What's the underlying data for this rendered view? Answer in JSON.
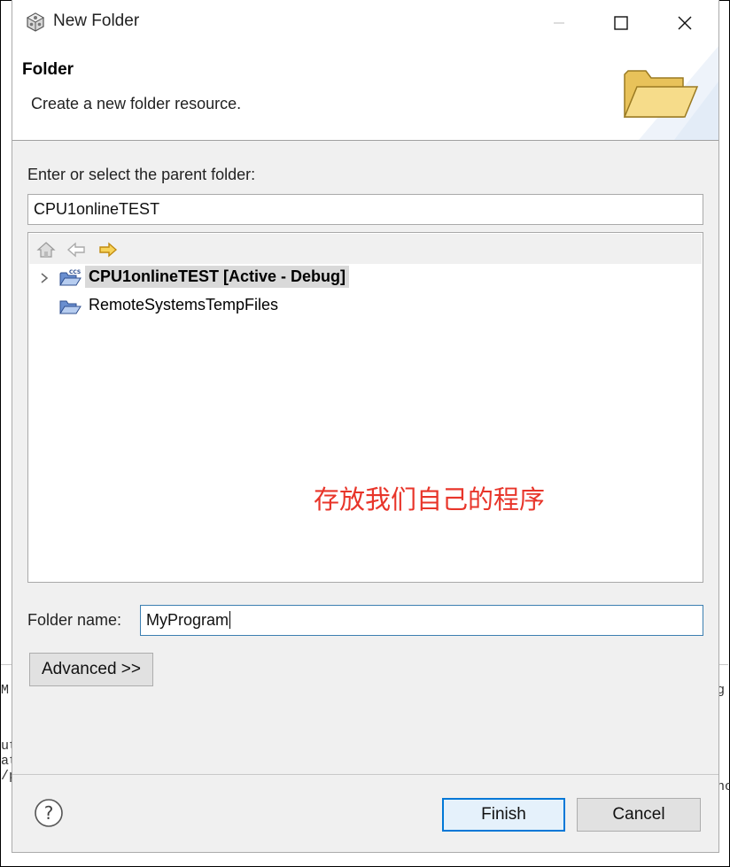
{
  "window": {
    "title": "New Folder",
    "icon": "gear-cube-icon"
  },
  "banner": {
    "title": "Folder",
    "description": "Create a new folder resource."
  },
  "parent_folder": {
    "label": "Enter or select the parent folder:",
    "value": "CPU1onlineTEST"
  },
  "tree": {
    "toolbar": [
      "home-icon",
      "back-arrow-icon",
      "forward-arrow-icon"
    ],
    "items": [
      {
        "label": "CPU1onlineTEST  [Active - Debug]",
        "icon": "ccs-project-folder-icon",
        "selected": true,
        "expandable": true
      },
      {
        "label": "RemoteSystemsTempFiles",
        "icon": "open-folder-icon",
        "selected": false,
        "expandable": false
      }
    ]
  },
  "annotation": "存放我们自己的程序",
  "folder_name": {
    "label": "Folder name:",
    "value": "MyProgram"
  },
  "buttons": {
    "advanced": "Advanced >>",
    "finish": "Finish",
    "cancel": "Cancel"
  },
  "colors": {
    "annotation": "#e8352a",
    "focus_border": "#3c7fb1",
    "default_button": "#0078d7"
  }
}
